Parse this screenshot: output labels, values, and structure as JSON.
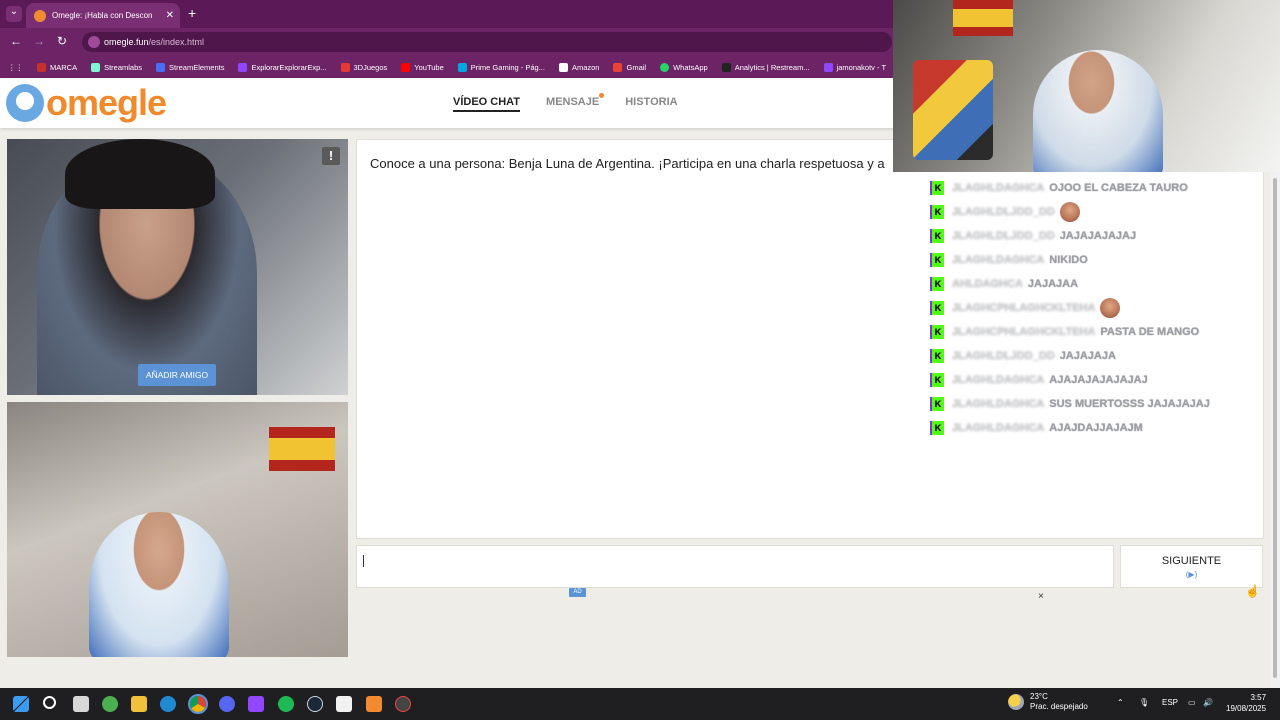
{
  "browser": {
    "tab_title": "Omegle: ¡Habla con Descon",
    "tab_close": "✕",
    "new_tab": "+",
    "tab_menu": "⌄",
    "url_host": "omegle.fun",
    "url_path": "/es/index.html",
    "back": "←",
    "forward": "→",
    "reload": "↻",
    "apps": "⋮⋮"
  },
  "bookmarks": [
    {
      "label": "MARCA",
      "color": "#c4302b"
    },
    {
      "label": "Streamlabs",
      "color": "#80f5d2"
    },
    {
      "label": "StreamElements",
      "color": "#4a6cf7"
    },
    {
      "label": "ExplorarExplorarExp...",
      "color": "#9146ff"
    },
    {
      "label": "3DJuegos",
      "color": "#e53935"
    },
    {
      "label": "YouTube",
      "color": "#ff0000"
    },
    {
      "label": "Prime Gaming - Pág...",
      "color": "#00a8e1"
    },
    {
      "label": "Amazon",
      "color": "#ffffff"
    },
    {
      "label": "Gmail",
      "color": "#ea4335"
    },
    {
      "label": "WhatsApp",
      "color": "#25d366"
    },
    {
      "label": "Analytics | Restream...",
      "color": "#222222"
    },
    {
      "label": "jamonakotv - T",
      "color": "#9146ff"
    }
  ],
  "site": {
    "logo": "omegle",
    "nav": [
      "VÍDEO CHAT",
      "MENSAJE",
      "HISTORIA"
    ]
  },
  "video": {
    "report": "!",
    "add_friend": "AÑADIR AMIGO"
  },
  "chat": {
    "message": "Conoce a una persona: Benja Luna de Argentina. ¡Participa en una charla respetuosa y a",
    "next_label": "SIGUIENTE",
    "next_icon": "(▶)",
    "ad_label": "AD",
    "ad_close": "×"
  },
  "stream_chat": [
    {
      "user": "JLAGHLDAGHCA",
      "msg": "OJOO EL CABEZA TAURO",
      "emote": false
    },
    {
      "user": "JLAGHLDLJDD_DD",
      "msg": "",
      "emote": true
    },
    {
      "user": "JLAGHLDLJDD_DD",
      "msg": "JAJAJAJAJAJ",
      "emote": false
    },
    {
      "user": "JLAGHLDAGHCA",
      "msg": "NIKIDO",
      "emote": false
    },
    {
      "user": "AHLDAGHCA",
      "msg": "JAJAJAA",
      "emote": false
    },
    {
      "user": "JLAGHCPHLAGHCKLTEHA",
      "msg": "",
      "emote": true
    },
    {
      "user": "JLAGHCPHLAGHCKLTEHA",
      "msg": "PASTA DE MANGO",
      "emote": false
    },
    {
      "user": "JLAGHLDLJDD_DD",
      "msg": "JAJAJAJA",
      "emote": false
    },
    {
      "user": "JLAGHLDAGHCA",
      "msg": "AJAJAJAJAJAJAJ",
      "emote": false
    },
    {
      "user": "JLAGHLDAGHCA",
      "msg": "SUS MUERTOSSS JAJAJAJAJ",
      "emote": false
    },
    {
      "user": "JLAGHLDAGHCA",
      "msg": "AJAJDAJJAJAJM",
      "emote": false
    }
  ],
  "taskbar": {
    "weather_temp": "23°C",
    "weather_desc": "Prac. despejado",
    "lang": "ESP",
    "time": "3:57",
    "date": "19/08/2025"
  },
  "colors": {
    "browser_frame": "#5b1a57",
    "omegle_orange": "#f08a2c",
    "omegle_blue": "#5b93d6",
    "kick_green": "#53fc18"
  }
}
